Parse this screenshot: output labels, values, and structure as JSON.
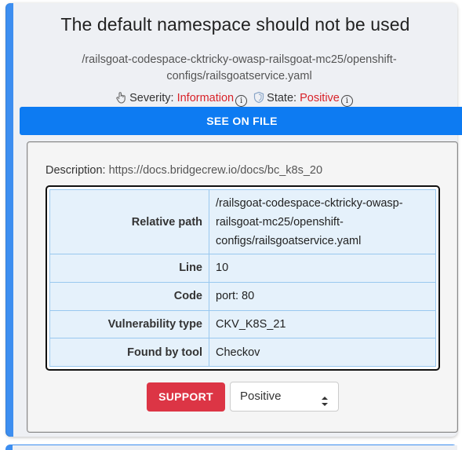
{
  "finding": {
    "title": "The default namespace should not be used",
    "path": "/railsgoat-codespace-cktricky-owasp-railsgoat-mc25/openshift-configs/railsgoatservice.yaml",
    "severity_label": "Severity:",
    "severity_value": "Information",
    "state_label": "State:",
    "state_value": "Positive"
  },
  "see_on_file_label": "SEE ON FILE",
  "description": {
    "label": "Description:",
    "link": "https://docs.bridgecrew.io/docs/bc_k8s_20"
  },
  "details": {
    "rows": [
      {
        "key": "Relative path",
        "value": "/railsgoat-codespace-cktricky-owasp-railsgoat-mc25/openshift-configs/railsgoatservice.yaml"
      },
      {
        "key": "Line",
        "value": "10"
      },
      {
        "key": "Code",
        "value": "port: 80"
      },
      {
        "key": "Vulnerability type",
        "value": "CKV_K8S_21"
      },
      {
        "key": "Found by tool",
        "value": "Checkov"
      }
    ]
  },
  "actions": {
    "support_label": "SUPPORT",
    "state_select_value": "Positive"
  },
  "colors": {
    "accent": "#0d7bf2",
    "danger": "#dc3545",
    "severity_text": "#d8232a"
  }
}
